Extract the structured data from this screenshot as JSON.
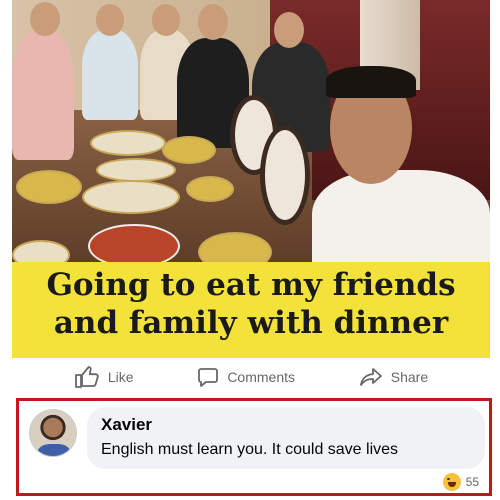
{
  "post": {
    "caption": "Going to eat my friends and family with dinner"
  },
  "actions": {
    "like": "Like",
    "comments": "Comments",
    "share": "Share"
  },
  "comment": {
    "author": "Xavier",
    "text": "English must learn you. It could save lives",
    "reaction_icon": "laughing-emoji-icon",
    "reaction_count": "55"
  },
  "colors": {
    "caption_band": "#f2e23a",
    "highlight_border": "#c0181c",
    "bubble": "#f0f2f5",
    "action_text": "#65676b"
  }
}
